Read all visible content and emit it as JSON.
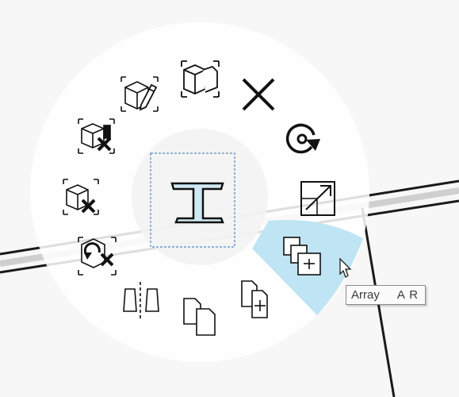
{
  "radial_menu": {
    "center_tool": "steel-beam-icon",
    "highlighted_item": "array",
    "highlight_color": "#bfe4f3",
    "items": [
      {
        "id": "copy-object",
        "icon": "cube-pair-icon"
      },
      {
        "id": "delete",
        "icon": "close-x-icon"
      },
      {
        "id": "rotate",
        "icon": "rotate-icon"
      },
      {
        "id": "scale",
        "icon": "scale-arrow-icon"
      },
      {
        "id": "array",
        "icon": "array-copies-icon"
      },
      {
        "id": "copy-plus",
        "icon": "copy-plus-icon"
      },
      {
        "id": "copy",
        "icon": "copy-pages-icon"
      },
      {
        "id": "mirror",
        "icon": "mirror-icon"
      },
      {
        "id": "undo-delete",
        "icon": "undo-delete-icon"
      },
      {
        "id": "remove-selection",
        "icon": "box-remove-icon"
      },
      {
        "id": "delete-component",
        "icon": "box-delete-icon"
      },
      {
        "id": "edit",
        "icon": "box-edit-icon"
      }
    ]
  },
  "tooltip": {
    "label": "Array",
    "shortcut": "A R"
  }
}
